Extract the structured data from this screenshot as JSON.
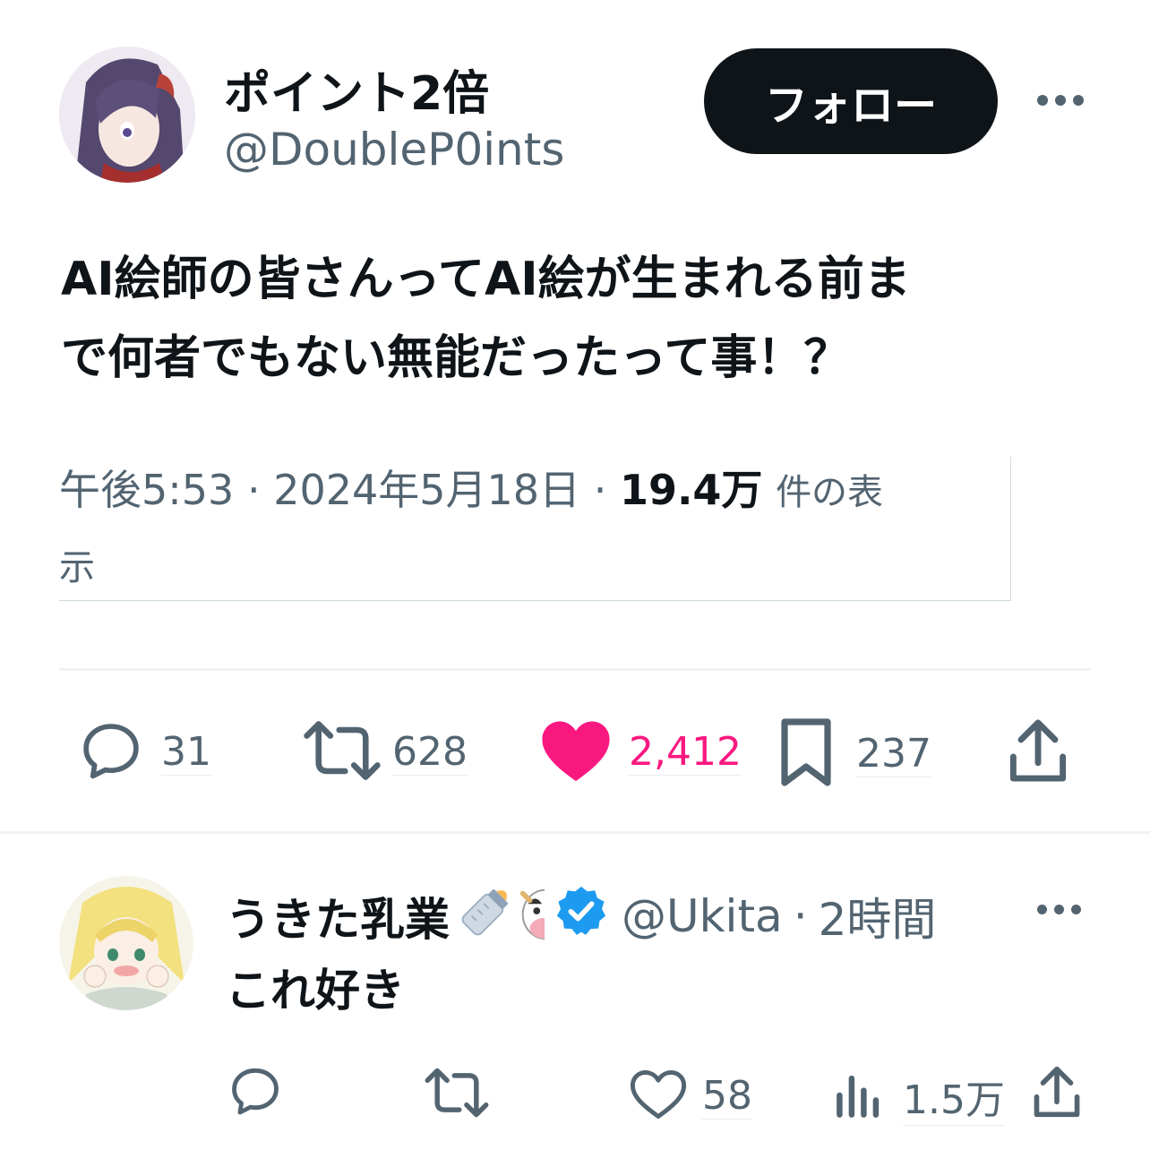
{
  "tweet": {
    "author_name": "ポイント2倍",
    "author_handle": "@DoubleP0ints",
    "follow_label": "フォロー",
    "text_line1": "AI絵師の皆さんってAI絵が生まれる前ま",
    "text_line2": "で何者でもない無能だったって事！？",
    "time": "午後5:53",
    "date": "2024年5月18日",
    "views_count": "19.4万",
    "views_label_a": "件の表",
    "views_label_b": "示",
    "separator": "·",
    "stats": {
      "replies": "31",
      "retweets": "628",
      "likes": "2,412",
      "bookmarks": "237"
    }
  },
  "reply": {
    "author_name": "うきた乳業",
    "author_handle": "@Ukita",
    "time_ago": "2時間",
    "separator": "·",
    "text": "これ好き",
    "stats": {
      "likes": "58",
      "views": "1.5万"
    }
  },
  "colors": {
    "like_active": "#f91880",
    "muted": "#536471",
    "verified": "#1d9bf0",
    "follow_button_bg": "#0f1419"
  },
  "icons": [
    "reply-icon",
    "retweet-icon",
    "heart-icon",
    "bookmark-icon",
    "share-icon",
    "more-icon",
    "verified-badge-icon",
    "views-icon",
    "baby-bottle-emoji",
    "cow-emoji"
  ]
}
